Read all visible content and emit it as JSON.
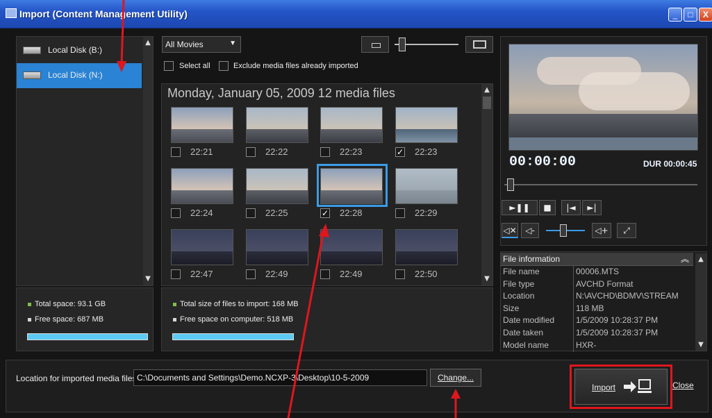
{
  "window": {
    "title": "Import (Content Management Utility)",
    "controls": [
      "_",
      "□",
      "X"
    ]
  },
  "drives": {
    "items": [
      {
        "label": "Local Disk (B:)",
        "selected": false
      },
      {
        "label": "Local Disk (N:)",
        "selected": true
      }
    ],
    "total_space": "Total space: 93.1 GB",
    "free_space": "Free space: 687 MB",
    "usage_fraction": 0.99
  },
  "filter": {
    "selected": "All Movies",
    "select_all_label": "Select all",
    "exclude_label": "Exclude media files already imported"
  },
  "media": {
    "group_header": "Monday, January 05, 2009 12 media files",
    "thumbnails": [
      {
        "time": "22:21",
        "checked": false,
        "scene": "clouds"
      },
      {
        "time": "22:22",
        "checked": false,
        "scene": "skyline"
      },
      {
        "time": "22:23",
        "checked": false,
        "scene": "skyline"
      },
      {
        "time": "22:23",
        "checked": true,
        "scene": "harbor"
      },
      {
        "time": "22:24",
        "checked": false,
        "scene": "clouds"
      },
      {
        "time": "22:25",
        "checked": false,
        "scene": "skyline"
      },
      {
        "time": "22:28",
        "checked": true,
        "scene": "clouds",
        "highlighted": true
      },
      {
        "time": "22:29",
        "checked": false,
        "scene": "boat"
      },
      {
        "time": "22:47",
        "checked": false,
        "scene": "night"
      },
      {
        "time": "22:49",
        "checked": false,
        "scene": "night"
      },
      {
        "time": "22:49",
        "checked": false,
        "scene": "night"
      },
      {
        "time": "22:50",
        "checked": false,
        "scene": "night"
      }
    ],
    "total_size": "Total size of files to import: 168 MB",
    "free_space_computer": "Free space on computer: 518 MB",
    "usage_fraction": 0.98
  },
  "player": {
    "timecode": "00:00:00",
    "duration": "DUR 00:00:45"
  },
  "file_info": {
    "header": "File information",
    "rows": [
      {
        "key": "File name",
        "value": "00006.MTS"
      },
      {
        "key": "File type",
        "value": "AVCHD Format"
      },
      {
        "key": "Location",
        "value": "N:\\AVCHD\\BDMV\\STREAM"
      },
      {
        "key": "Size",
        "value": "118 MB"
      },
      {
        "key": "Date modified",
        "value": "1/5/2009 10:28:37 PM"
      },
      {
        "key": "Date taken",
        "value": "1/5/2009 10:28:37 PM"
      },
      {
        "key": "Model name",
        "value": "HXR-"
      }
    ]
  },
  "footer": {
    "location_label": "Location for imported media files:",
    "location_value": "C:\\Documents and Settings\\Demo.NCXP-3\\Desktop\\10-5-2009",
    "change_label": "Change...",
    "import_label": "Import",
    "close_label": "Close"
  },
  "colors": {
    "accent": "#2a83d4",
    "annotation": "#e0161d",
    "progress": "#5ccbf2"
  }
}
